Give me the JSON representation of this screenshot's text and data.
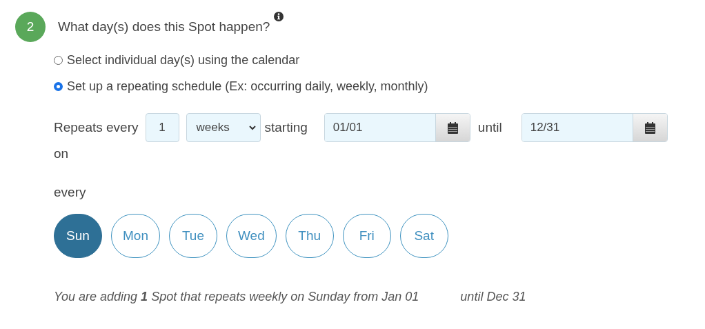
{
  "step": {
    "number": "2",
    "title": "What day(s) does this Spot happen?"
  },
  "options": [
    {
      "label": "Select individual day(s) using the calendar",
      "selected": false
    },
    {
      "label": "Set up a repeating schedule (Ex: occurring daily, weekly, monthly)",
      "selected": true
    }
  ],
  "repeat": {
    "label": "Repeats every",
    "interval": "1",
    "unit": "weeks",
    "starting_label": "starting",
    "start_date": "01/01",
    "until_label": "until",
    "end_date": "12/31",
    "on_label": "on"
  },
  "every_label": "every",
  "days": [
    {
      "label": "Sun",
      "selected": true
    },
    {
      "label": "Mon",
      "selected": false
    },
    {
      "label": "Tue",
      "selected": false
    },
    {
      "label": "Wed",
      "selected": false
    },
    {
      "label": "Thu",
      "selected": false
    },
    {
      "label": "Fri",
      "selected": false
    },
    {
      "label": "Sat",
      "selected": false
    }
  ],
  "summary": [
    "You are adding **1** Spot that repeats weekly on Sunday from Jan 01",
    "until Dec 31"
  ]
}
